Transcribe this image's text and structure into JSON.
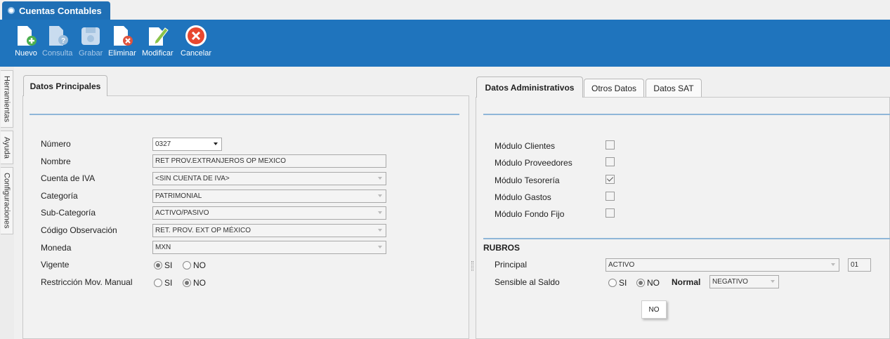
{
  "window": {
    "title": "Cuentas Contables"
  },
  "toolbar": {
    "nuevo": "Nuevo",
    "consulta": "Consulta",
    "grabar": "Grabar",
    "eliminar": "Eliminar",
    "modificar": "Modificar",
    "cancelar": "Cancelar"
  },
  "side_tabs": {
    "herramientas": "Herramientas",
    "ayuda": "Ayuda",
    "configuraciones": "Configuraciones"
  },
  "left_panel": {
    "tab": "Datos Principales",
    "numero": {
      "label": "Número",
      "value": "0327"
    },
    "nombre": {
      "label": "Nombre",
      "value": "RET PROV.EXTRANJEROS OP MEXICO"
    },
    "cuenta_iva": {
      "label": "Cuenta de IVA",
      "value": "<SIN CUENTA DE IVA>"
    },
    "categoria": {
      "label": "Categoría",
      "value": "PATRIMONIAL"
    },
    "sub_categoria": {
      "label": "Sub-Categoría",
      "value": "ACTIVO/PASIVO"
    },
    "codigo_obs": {
      "label": "Código Observación",
      "value": "RET. PROV. EXT OP MÉXICO"
    },
    "moneda": {
      "label": "Moneda",
      "value": "MXN"
    },
    "vigente": {
      "label": "Vigente",
      "si": "SI",
      "no": "NO",
      "selected": "SI"
    },
    "restriccion": {
      "label": "Restricción Mov. Manual",
      "si": "SI",
      "no": "NO",
      "selected": "NO"
    }
  },
  "right_panel": {
    "tabs": [
      "Datos Administrativos",
      "Otros Datos",
      "Datos SAT"
    ],
    "modulos": [
      {
        "label": "Módulo Clientes",
        "checked": false
      },
      {
        "label": "Módulo Proveedores",
        "checked": false
      },
      {
        "label": "Módulo Tesorería",
        "checked": true
      },
      {
        "label": "Módulo Gastos",
        "checked": false
      },
      {
        "label": "Módulo Fondo Fijo",
        "checked": false
      }
    ],
    "rubros": {
      "heading": "RUBROS",
      "principal_label": "Principal",
      "principal_value": "ACTIVO",
      "principal_code": "01",
      "sensible_label": "Sensible al Saldo",
      "si": "SI",
      "no": "NO",
      "selected": "NO",
      "normal_label": "Normal",
      "normal_value": "NEGATIVO",
      "popup_value": "NO"
    }
  }
}
